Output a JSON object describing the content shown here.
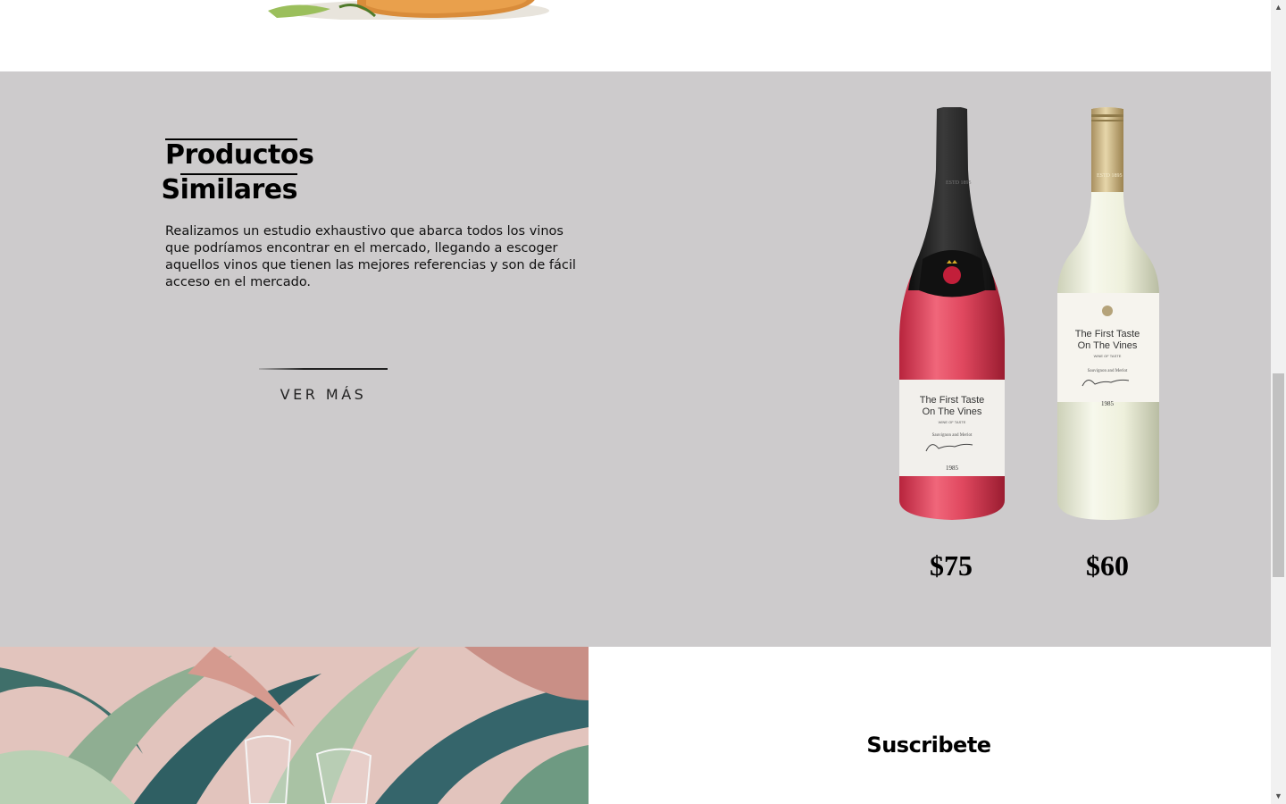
{
  "products_section": {
    "title_line1": "Productos",
    "title_line2": "Similares",
    "description": "Realizamos un estudio exhaustivo que abarca todos los vinos que podríamos encontrar en el mercado, llegando a escoger aquellos vinos que tienen las mejores referencias y son de fácil acceso en el mercado.",
    "cta_label": "VER MÁS",
    "products": [
      {
        "label_line1": "The First Taste",
        "label_line2": "On The Vines",
        "label_small": "WINE OF TASTE",
        "label_variety": "Sauvignon and Merlot",
        "label_year": "1985",
        "neck_text": "ESTD 1895",
        "price": "$75",
        "bottle_color": "#e0485f",
        "capsule_color": "#1c1c1c"
      },
      {
        "label_line1": "The First Taste",
        "label_line2": "On The Vines",
        "label_small": "WINE OF TASTE",
        "label_variety": "Sauvignon and Merlot",
        "label_year": "1985",
        "neck_text": "ESTD 1895",
        "price": "$60",
        "bottle_color": "#eef0dc",
        "capsule_color": "#c9b58a"
      }
    ]
  },
  "subscribe": {
    "title": "Suscribete"
  },
  "colors": {
    "section_background": "#cdcbcc",
    "page_background": "#ffffff"
  }
}
